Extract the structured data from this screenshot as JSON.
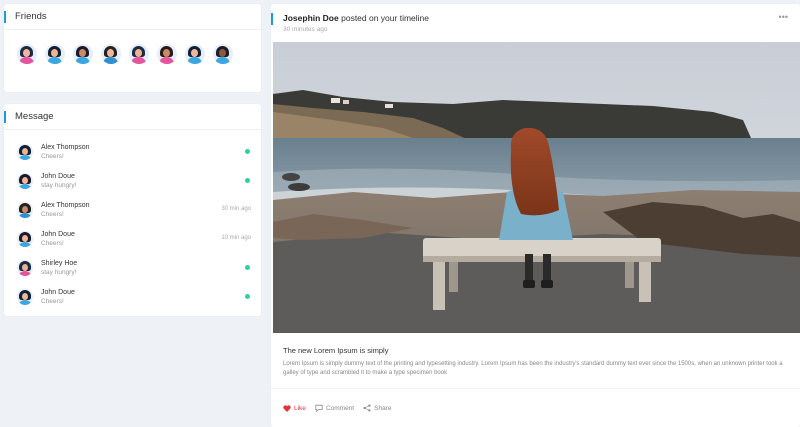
{
  "friends": {
    "title": "Friends",
    "avatars": [
      {
        "icon": "avatar-woman-pink",
        "shirt": "#e5559e",
        "hair": "#1c2a4a",
        "skin": "#f2b79b"
      },
      {
        "icon": "avatar-man-blue",
        "shirt": "#3aa7e0",
        "hair": "#0f1f38",
        "skin": "#f0b48d"
      },
      {
        "icon": "avatar-woman-blue",
        "shirt": "#3aa7e0",
        "hair": "#1a1a2a",
        "skin": "#c98a66"
      },
      {
        "icon": "avatar-man-blue",
        "shirt": "#2f8fd0",
        "hair": "#222",
        "skin": "#f2b79b"
      },
      {
        "icon": "avatar-woman-pink",
        "shirt": "#e5559e",
        "hair": "#1c2a4a",
        "skin": "#f0b48d"
      },
      {
        "icon": "avatar-woman-pink",
        "shirt": "#e5559e",
        "hair": "#2a1a1a",
        "skin": "#c98a66"
      },
      {
        "icon": "avatar-man-blue",
        "shirt": "#3aa7e0",
        "hair": "#0f1f38",
        "skin": "#f2b79b"
      },
      {
        "icon": "avatar-man-blue",
        "shirt": "#3aa7e0",
        "hair": "#1a1a2a",
        "skin": "#8a5a3c"
      }
    ]
  },
  "messages": {
    "title": "Message",
    "items": [
      {
        "name": "Alex Thompson",
        "preview": "Cheers!",
        "status": "online",
        "time": "",
        "shirt": "#3aa7e0",
        "hair": "#0f1f38",
        "skin": "#f0b48d"
      },
      {
        "name": "John Doue",
        "preview": "stay hungry!",
        "status": "online",
        "time": "",
        "shirt": "#3aa7e0",
        "hair": "#1a1a2a",
        "skin": "#f2b79b"
      },
      {
        "name": "Alex Thompson",
        "preview": "Cheers!",
        "status": "",
        "time": "30 min ago",
        "shirt": "#2f8fd0",
        "hair": "#222",
        "skin": "#c98a66"
      },
      {
        "name": "John Doue",
        "preview": "Cheers!",
        "status": "",
        "time": "10 min ago",
        "shirt": "#3aa7e0",
        "hair": "#1a1a2a",
        "skin": "#f2b79b"
      },
      {
        "name": "Shirley Hoe",
        "preview": "stay hungry!",
        "status": "online",
        "time": "",
        "shirt": "#e5559e",
        "hair": "#1c2a4a",
        "skin": "#f0b48d"
      },
      {
        "name": "John Doue",
        "preview": "Cheers!",
        "status": "online",
        "time": "",
        "shirt": "#3aa7e0",
        "hair": "#0f1f38",
        "skin": "#f2b79b"
      }
    ]
  },
  "post": {
    "author": "Josephin Doe",
    "action_text": "posted on your timeline",
    "time": "30 minutes ago",
    "more_icon": "more-horizontal-icon",
    "photo_icon": "photo-woman-on-bench",
    "heading": "The new Lorem Ipsum is simply",
    "body": "Lorem Ipsum is simply dummy text of the printing and typesetting industry. Lorem Ipsum has been the industry's standard dummy text ever since the 1500s, when an unknown printer took a galley of type and scrambled it to make a type specimen book",
    "actions": {
      "like": "Like",
      "comment": "Comment",
      "share": "Share"
    }
  },
  "colors": {
    "accent": "#1e9ad6",
    "online": "#2fd0a0",
    "like": "#e0353b",
    "background": "#eef2f7"
  }
}
